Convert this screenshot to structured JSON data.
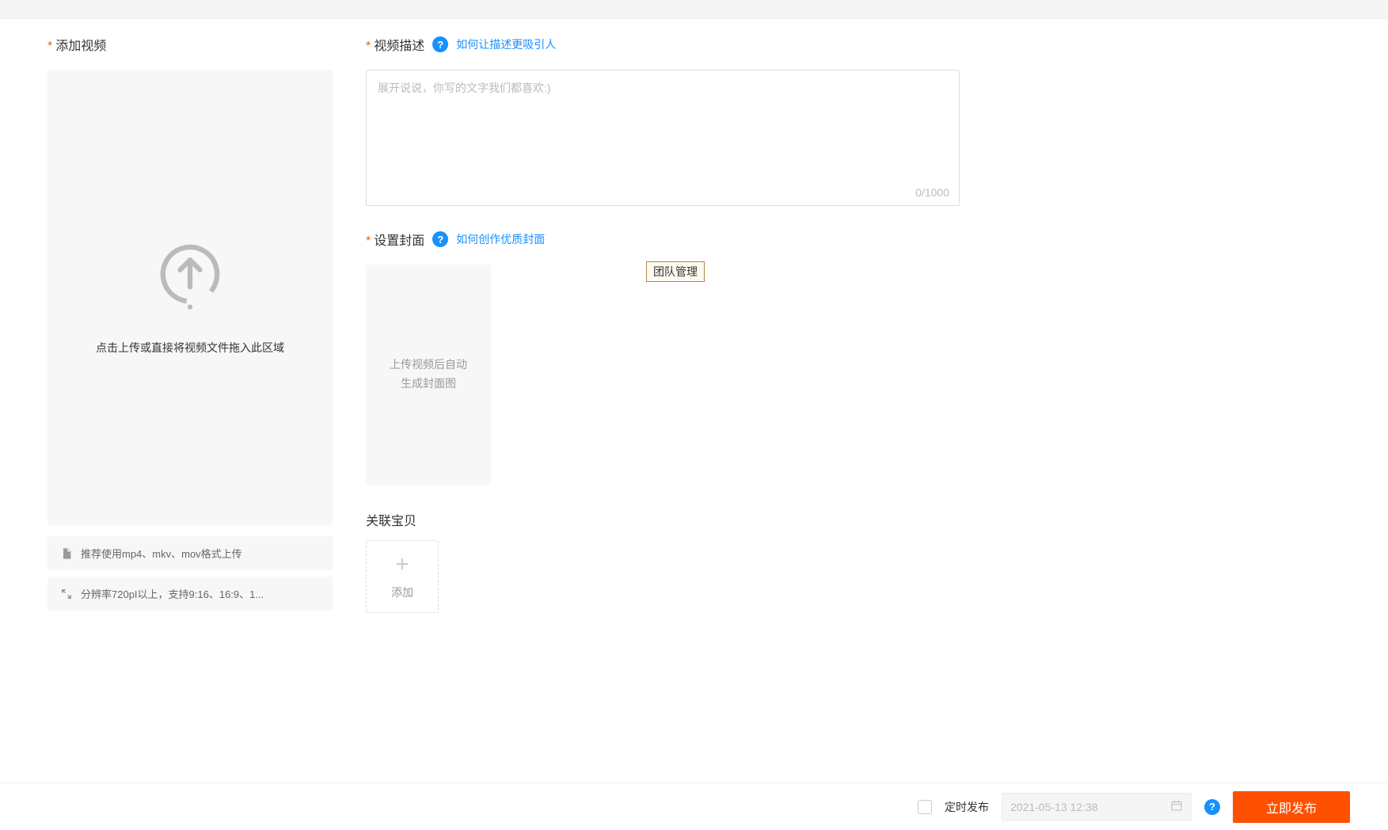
{
  "left": {
    "title": "添加视频",
    "upload_text": "点击上传或直接将视频文件拖入此区域",
    "hint1": "推荐使用mp4、mkv、mov格式上传",
    "hint2": "分辨率720pI以上，支持9:16、16:9、1..."
  },
  "desc": {
    "title": "视频描述",
    "help_link": "如何让描述更吸引人",
    "placeholder": "展开说说，你写的文字我们都喜欢:)",
    "count": "0/1000"
  },
  "cover": {
    "title": "设置封面",
    "help_link": "如何创作优质封面",
    "line1": "上传视频后自动",
    "line2": "生成封面图"
  },
  "tooltip": "团队管理",
  "related": {
    "title": "关联宝贝",
    "add_label": "添加"
  },
  "footer": {
    "sched_label": "定时发布",
    "date_value": "2021-05-13 12:38",
    "publish": "立即发布"
  }
}
